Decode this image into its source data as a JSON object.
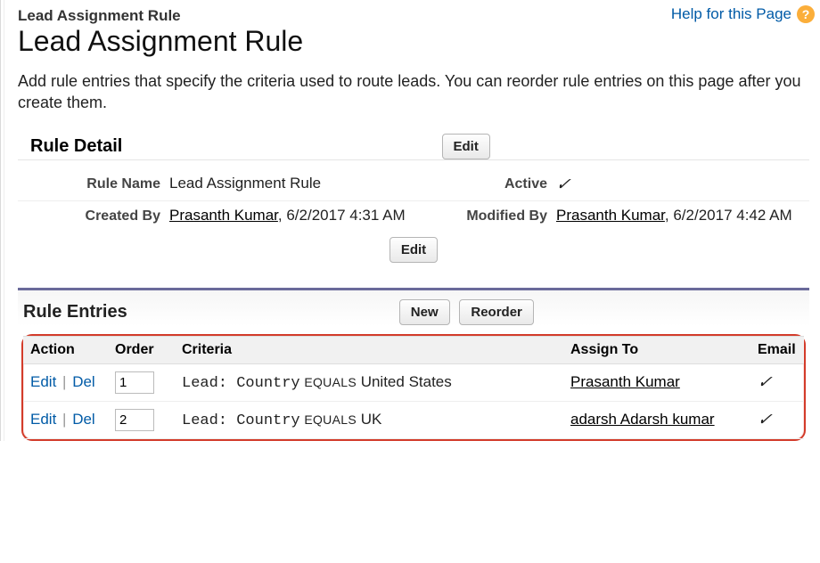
{
  "breadcrumb": "Lead Assignment Rule",
  "title": "Lead Assignment Rule",
  "help_label": "Help for this Page",
  "description": "Add rule entries that specify the criteria used to route leads. You can reorder rule entries on this page after you create them.",
  "rule_detail": {
    "heading": "Rule Detail",
    "edit_label": "Edit",
    "labels": {
      "rule_name": "Rule Name",
      "active": "Active",
      "created_by": "Created By",
      "modified_by": "Modified By"
    },
    "rule_name": "Lead Assignment Rule",
    "active": "✓",
    "created_by_user": "Prasanth Kumar",
    "created_by_date": ", 6/2/2017 4:31 AM",
    "modified_by_user": "Prasanth Kumar",
    "modified_by_date": ", 6/2/2017 4:42 AM"
  },
  "rule_entries": {
    "heading": "Rule Entries",
    "new_label": "New",
    "reorder_label": "Reorder",
    "columns": {
      "action": "Action",
      "order": "Order",
      "criteria": "Criteria",
      "assign_to": "Assign To",
      "email": "Email"
    },
    "action_edit": "Edit",
    "action_del": "Del",
    "rows": [
      {
        "order": "1",
        "criteria_prefix": "Lead: Country",
        "criteria_op": "EQUALS",
        "criteria_value": "United States",
        "assign_to": "Prasanth Kumar",
        "email": "✓"
      },
      {
        "order": "2",
        "criteria_prefix": "Lead: Country",
        "criteria_op": "EQUALS",
        "criteria_value": "UK",
        "assign_to": "adarsh Adarsh kumar",
        "email": "✓"
      }
    ]
  }
}
